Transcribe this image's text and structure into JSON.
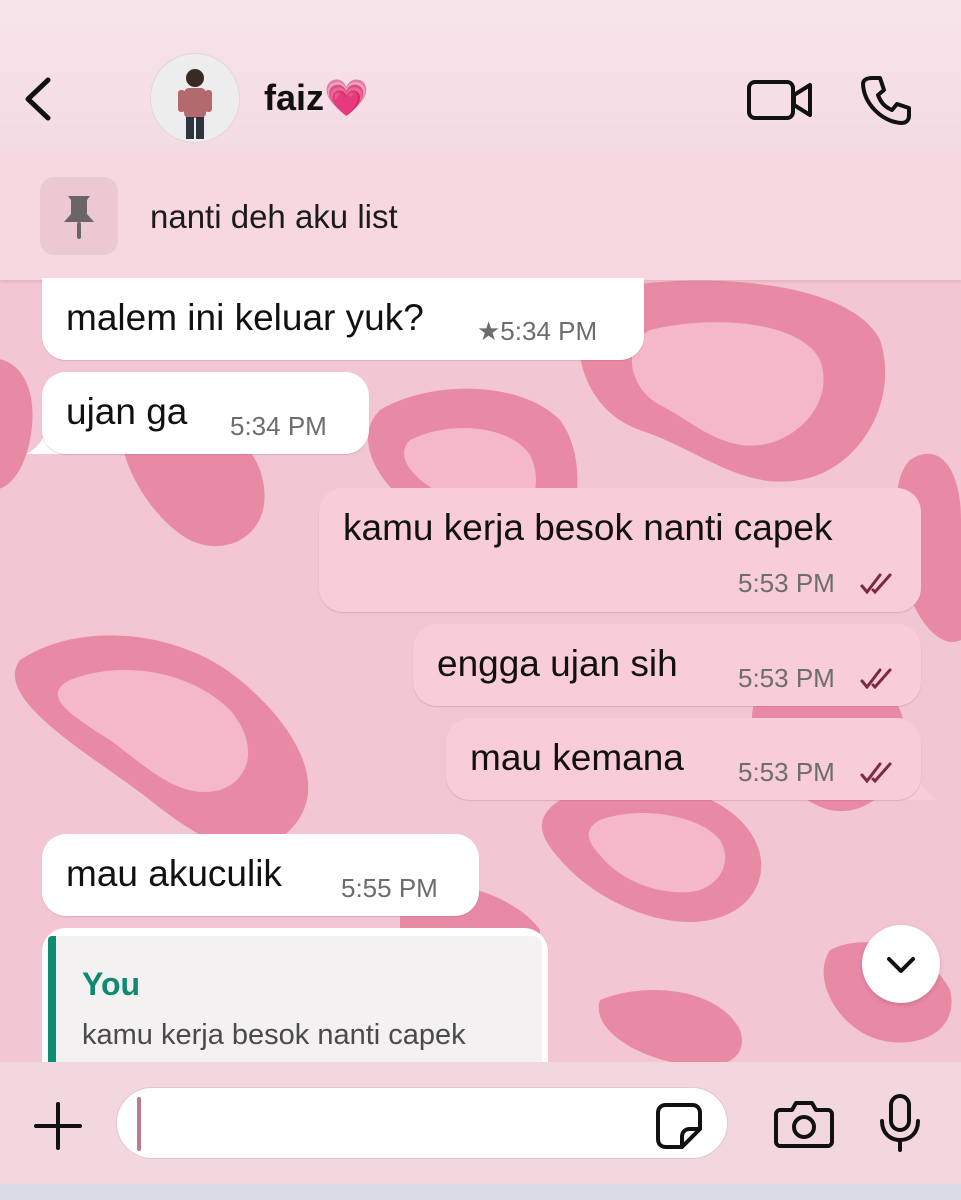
{
  "colors": {
    "background": "#f3c6d3",
    "blob": "#e98aa5",
    "blob_inner": "#f5b8c8",
    "incoming_bubble": "#ffffff",
    "outgoing_bubble": "#f8cdd7",
    "read_ticks": "#7b2a44",
    "reply_accent": "#0e8a72"
  },
  "header": {
    "back_icon": "chevron-left-icon",
    "contact_name": "faiz💗",
    "video_icon": "video-camera-icon",
    "call_icon": "phone-icon"
  },
  "pinned": {
    "icon": "pin-icon",
    "text": "nanti deh aku list"
  },
  "messages": [
    {
      "direction": "in",
      "text": "malem ini keluar yuk?",
      "time": "★5:34 PM",
      "starred": true
    },
    {
      "direction": "in",
      "text": "ujan ga",
      "time": "5:34 PM"
    },
    {
      "direction": "out",
      "text": "kamu kerja besok nanti capek",
      "time": "5:53 PM",
      "status": "read"
    },
    {
      "direction": "out",
      "text": "engga ujan sih",
      "time": "5:53 PM",
      "status": "read"
    },
    {
      "direction": "out",
      "text": "mau kemana",
      "time": "5:53 PM",
      "status": "read"
    },
    {
      "direction": "in",
      "text": "mau akuculik",
      "time": "5:55 PM"
    }
  ],
  "reply_preview": {
    "author": "You",
    "quoted_text": "kamu kerja besok nanti capek"
  },
  "scroll_down_icon": "chevron-down-icon",
  "composer": {
    "plus_icon": "plus-icon",
    "input_value": "",
    "sticker_icon": "sticker-icon",
    "camera_icon": "camera-icon",
    "mic_icon": "microphone-icon"
  }
}
